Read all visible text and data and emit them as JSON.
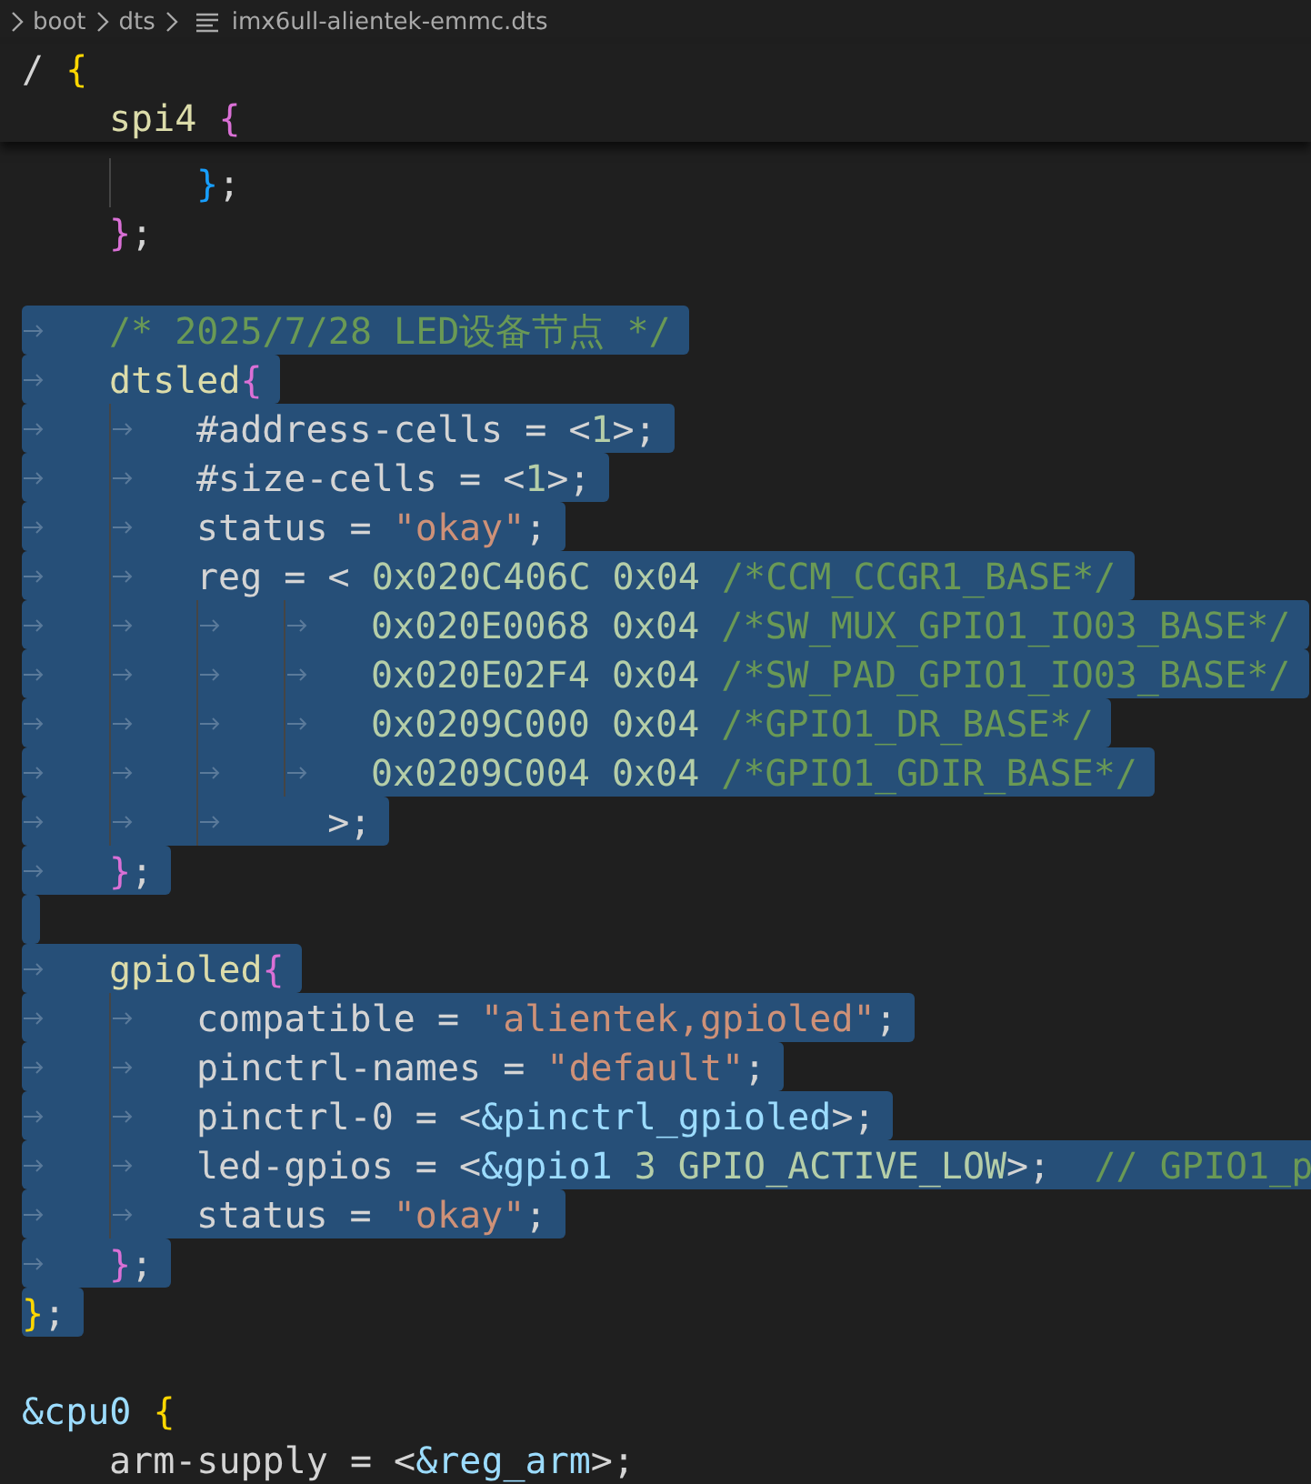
{
  "breadcrumb": [
    {
      "label": "boot",
      "kind": "folder"
    },
    {
      "label": "dts",
      "kind": "folder"
    },
    {
      "label": "imx6ull-alientek-emmc.dts",
      "kind": "file"
    }
  ],
  "sticky_lines": [
    {
      "spans": [
        {
          "text": "/ ",
          "kind": "plain"
        },
        {
          "text": "{",
          "kind": "brace1"
        }
      ]
    },
    {
      "spans": [
        {
          "text": "\tspi4 ",
          "kind": "node"
        },
        {
          "text": "{",
          "kind": "brace2"
        }
      ]
    }
  ],
  "lines": [
    {
      "selected": false,
      "spans": [
        {
          "text": "\t\t}",
          "kind": "brace3"
        },
        {
          "text": ";",
          "kind": "plain"
        }
      ]
    },
    {
      "selected": false,
      "spans": [
        {
          "text": "\t}",
          "kind": "brace2"
        },
        {
          "text": ";",
          "kind": "plain"
        }
      ]
    },
    {
      "selected": false
    },
    {
      "selected": true,
      "spans": [
        {
          "text": "\t/* 2025/7/28 LED设备节点 */",
          "kind": "comment"
        }
      ]
    },
    {
      "selected": true,
      "spans": [
        {
          "text": "\tdtsled",
          "kind": "node"
        },
        {
          "text": "{",
          "kind": "brace2"
        }
      ]
    },
    {
      "selected": true,
      "spans": [
        {
          "text": "\t\t#address-cells = <",
          "kind": "plain"
        },
        {
          "text": "1",
          "kind": "number"
        },
        {
          "text": ">;",
          "kind": "plain"
        }
      ]
    },
    {
      "selected": true,
      "spans": [
        {
          "text": "\t\t#size-cells = <",
          "kind": "plain"
        },
        {
          "text": "1",
          "kind": "number"
        },
        {
          "text": ">;",
          "kind": "plain"
        }
      ]
    },
    {
      "selected": true,
      "spans": [
        {
          "text": "\t\tstatus = ",
          "kind": "plain"
        },
        {
          "text": "\"okay\"",
          "kind": "string"
        },
        {
          "text": ";",
          "kind": "plain"
        }
      ]
    },
    {
      "selected": true,
      "spans": [
        {
          "text": "\t\treg = < ",
          "kind": "plain"
        },
        {
          "text": "0x020C406C 0x04 ",
          "kind": "number"
        },
        {
          "text": "/*CCM_CCGR1_BASE*/",
          "kind": "comment"
        }
      ]
    },
    {
      "selected": true,
      "spans": [
        {
          "text": "\t\t\t\t0x020E0068 0x04 ",
          "kind": "number"
        },
        {
          "text": "/*SW_MUX_GPIO1_IO03_BASE*/",
          "kind": "comment"
        }
      ]
    },
    {
      "selected": true,
      "spans": [
        {
          "text": "\t\t\t\t0x020E02F4 0x04 ",
          "kind": "number"
        },
        {
          "text": "/*SW_PAD_GPIO1_IO03_BASE*/",
          "kind": "comment"
        }
      ]
    },
    {
      "selected": true,
      "spans": [
        {
          "text": "\t\t\t\t0x0209C000 0x04 ",
          "kind": "number"
        },
        {
          "text": "/*GPIO1_DR_BASE*/",
          "kind": "comment"
        }
      ]
    },
    {
      "selected": true,
      "spans": [
        {
          "text": "\t\t\t\t0x0209C004 0x04 ",
          "kind": "number"
        },
        {
          "text": "/*GPIO1_GDIR_BASE*/",
          "kind": "comment"
        }
      ]
    },
    {
      "selected": true,
      "spans": [
        {
          "text": "\t\t\t  >;",
          "kind": "plain"
        }
      ]
    },
    {
      "selected": true,
      "spans": [
        {
          "text": "\t}",
          "kind": "brace2"
        },
        {
          "text": ";",
          "kind": "plain"
        }
      ]
    },
    {
      "selected": true
    },
    {
      "selected": true,
      "spans": [
        {
          "text": "\tgpioled",
          "kind": "node"
        },
        {
          "text": "{",
          "kind": "brace2"
        }
      ]
    },
    {
      "selected": true,
      "spans": [
        {
          "text": "\t\tcompatible = ",
          "kind": "plain"
        },
        {
          "text": "\"alientek,gpioled\"",
          "kind": "string"
        },
        {
          "text": ";",
          "kind": "plain"
        }
      ]
    },
    {
      "selected": true,
      "spans": [
        {
          "text": "\t\tpinctrl-names = ",
          "kind": "plain"
        },
        {
          "text": "\"default\"",
          "kind": "string"
        },
        {
          "text": ";",
          "kind": "plain"
        }
      ]
    },
    {
      "selected": true,
      "spans": [
        {
          "text": "\t\tpinctrl-0 = <",
          "kind": "plain"
        },
        {
          "text": "&pinctrl_gpioled",
          "kind": "ref"
        },
        {
          "text": ">;",
          "kind": "plain"
        }
      ]
    },
    {
      "selected": true,
      "spans": [
        {
          "text": "\t\tled-gpios = <",
          "kind": "plain"
        },
        {
          "text": "&gpio1",
          "kind": "ref"
        },
        {
          "text": " 3 GPIO_ACTIVE_LOW",
          "kind": "number"
        },
        {
          "text": ">;  ",
          "kind": "plain"
        },
        {
          "text": "// GPIO1_p",
          "kind": "comment"
        }
      ]
    },
    {
      "selected": true,
      "spans": [
        {
          "text": "\t\tstatus = ",
          "kind": "plain"
        },
        {
          "text": "\"okay\"",
          "kind": "string"
        },
        {
          "text": ";",
          "kind": "plain"
        }
      ]
    },
    {
      "selected": true,
      "spans": [
        {
          "text": "\t}",
          "kind": "brace2"
        },
        {
          "text": ";",
          "kind": "plain"
        }
      ]
    },
    {
      "selected": true,
      "spans": [
        {
          "text": "}",
          "kind": "brace1"
        },
        {
          "text": ";",
          "kind": "plain"
        }
      ]
    },
    {
      "selected": false
    },
    {
      "selected": false,
      "spans": [
        {
          "text": "&cpu0 ",
          "kind": "ref"
        },
        {
          "text": "{",
          "kind": "brace1"
        }
      ]
    },
    {
      "selected": false,
      "spans": [
        {
          "text": "\tarm-supply = <",
          "kind": "plain"
        },
        {
          "text": "&reg_arm",
          "kind": "ref"
        },
        {
          "text": ">;",
          "kind": "plain"
        }
      ]
    }
  ]
}
